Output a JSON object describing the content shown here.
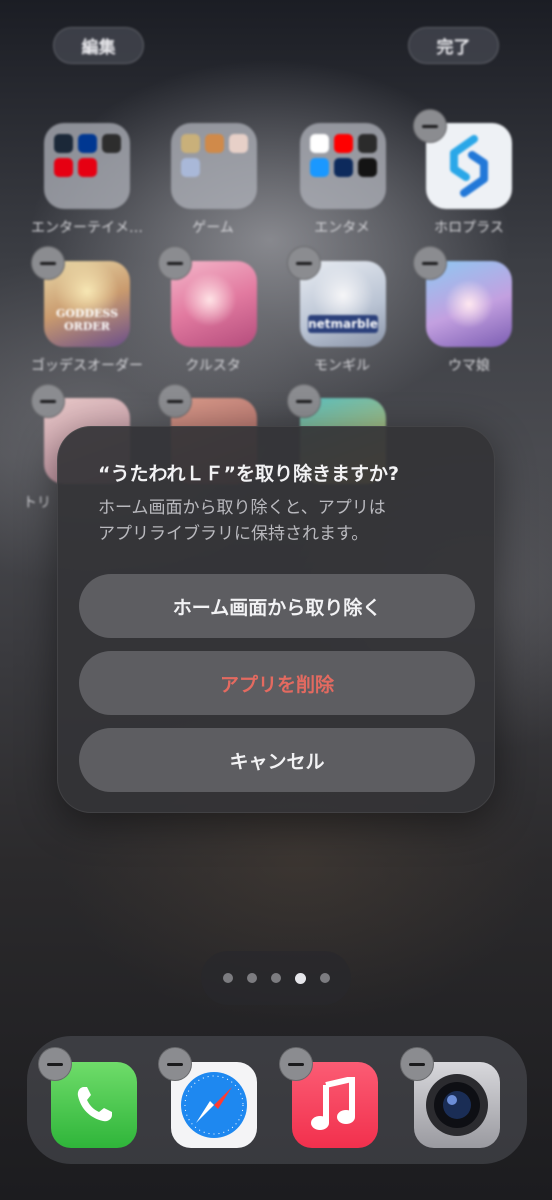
{
  "header": {
    "edit_label": "編集",
    "done_label": "完了"
  },
  "apps": [
    {
      "label": "エンターテイメ…",
      "type": "folder"
    },
    {
      "label": "ゲーム",
      "type": "folder"
    },
    {
      "label": "エンタメ",
      "type": "folder"
    },
    {
      "label": "ホロプラス",
      "type": "app"
    },
    {
      "label": "ゴッデスオーダー",
      "type": "app",
      "art_text": "GODDESS ORDER"
    },
    {
      "label": "クルスタ",
      "type": "app"
    },
    {
      "label": "モンギル",
      "type": "app",
      "art_text": "netmarble"
    },
    {
      "label": "ウマ娘",
      "type": "app"
    },
    {
      "label": "トリ",
      "type": "app"
    }
  ],
  "dialog": {
    "title": "“うたわれＬＦ”を取り除きますか?",
    "message": "ホーム画面から取り除くと、アプリは\nアプリライブラリに保持されます。",
    "remove_from_home": "ホーム画面から取り除く",
    "delete_app": "アプリを削除",
    "cancel": "キャンセル"
  },
  "page_indicator": {
    "pages": 5,
    "current": 4
  },
  "dock": [
    "phone-icon",
    "safari-icon",
    "music-icon",
    "camera-icon"
  ],
  "colors": {
    "destructive": "#e36a60",
    "dialog_bg": "#343437",
    "button_bg": "#5d5d61"
  }
}
